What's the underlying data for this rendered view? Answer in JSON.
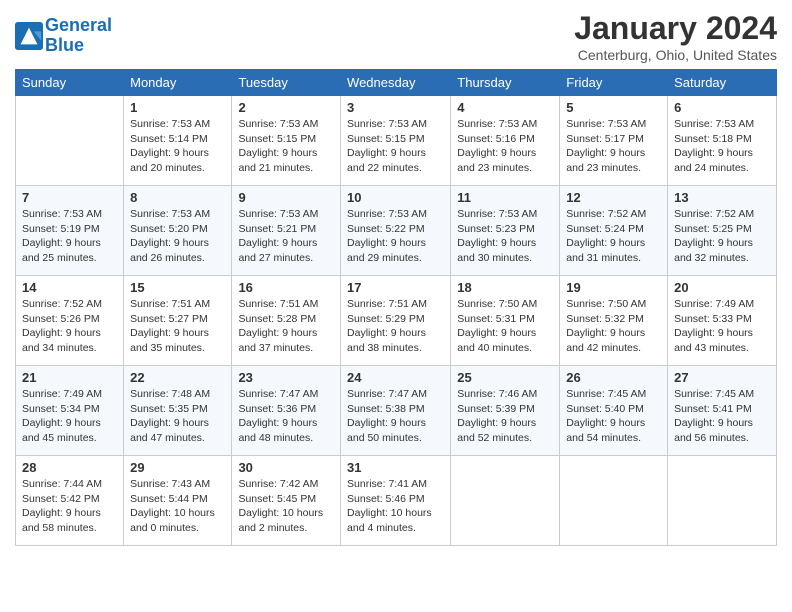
{
  "header": {
    "logo_line1": "General",
    "logo_line2": "Blue",
    "month": "January 2024",
    "location": "Centerburg, Ohio, United States"
  },
  "weekdays": [
    "Sunday",
    "Monday",
    "Tuesday",
    "Wednesday",
    "Thursday",
    "Friday",
    "Saturday"
  ],
  "weeks": [
    [
      {
        "day": "",
        "text": ""
      },
      {
        "day": "1",
        "text": "Sunrise: 7:53 AM\nSunset: 5:14 PM\nDaylight: 9 hours\nand 20 minutes."
      },
      {
        "day": "2",
        "text": "Sunrise: 7:53 AM\nSunset: 5:15 PM\nDaylight: 9 hours\nand 21 minutes."
      },
      {
        "day": "3",
        "text": "Sunrise: 7:53 AM\nSunset: 5:15 PM\nDaylight: 9 hours\nand 22 minutes."
      },
      {
        "day": "4",
        "text": "Sunrise: 7:53 AM\nSunset: 5:16 PM\nDaylight: 9 hours\nand 23 minutes."
      },
      {
        "day": "5",
        "text": "Sunrise: 7:53 AM\nSunset: 5:17 PM\nDaylight: 9 hours\nand 23 minutes."
      },
      {
        "day": "6",
        "text": "Sunrise: 7:53 AM\nSunset: 5:18 PM\nDaylight: 9 hours\nand 24 minutes."
      }
    ],
    [
      {
        "day": "7",
        "text": "Sunrise: 7:53 AM\nSunset: 5:19 PM\nDaylight: 9 hours\nand 25 minutes."
      },
      {
        "day": "8",
        "text": "Sunrise: 7:53 AM\nSunset: 5:20 PM\nDaylight: 9 hours\nand 26 minutes."
      },
      {
        "day": "9",
        "text": "Sunrise: 7:53 AM\nSunset: 5:21 PM\nDaylight: 9 hours\nand 27 minutes."
      },
      {
        "day": "10",
        "text": "Sunrise: 7:53 AM\nSunset: 5:22 PM\nDaylight: 9 hours\nand 29 minutes."
      },
      {
        "day": "11",
        "text": "Sunrise: 7:53 AM\nSunset: 5:23 PM\nDaylight: 9 hours\nand 30 minutes."
      },
      {
        "day": "12",
        "text": "Sunrise: 7:52 AM\nSunset: 5:24 PM\nDaylight: 9 hours\nand 31 minutes."
      },
      {
        "day": "13",
        "text": "Sunrise: 7:52 AM\nSunset: 5:25 PM\nDaylight: 9 hours\nand 32 minutes."
      }
    ],
    [
      {
        "day": "14",
        "text": "Sunrise: 7:52 AM\nSunset: 5:26 PM\nDaylight: 9 hours\nand 34 minutes."
      },
      {
        "day": "15",
        "text": "Sunrise: 7:51 AM\nSunset: 5:27 PM\nDaylight: 9 hours\nand 35 minutes."
      },
      {
        "day": "16",
        "text": "Sunrise: 7:51 AM\nSunset: 5:28 PM\nDaylight: 9 hours\nand 37 minutes."
      },
      {
        "day": "17",
        "text": "Sunrise: 7:51 AM\nSunset: 5:29 PM\nDaylight: 9 hours\nand 38 minutes."
      },
      {
        "day": "18",
        "text": "Sunrise: 7:50 AM\nSunset: 5:31 PM\nDaylight: 9 hours\nand 40 minutes."
      },
      {
        "day": "19",
        "text": "Sunrise: 7:50 AM\nSunset: 5:32 PM\nDaylight: 9 hours\nand 42 minutes."
      },
      {
        "day": "20",
        "text": "Sunrise: 7:49 AM\nSunset: 5:33 PM\nDaylight: 9 hours\nand 43 minutes."
      }
    ],
    [
      {
        "day": "21",
        "text": "Sunrise: 7:49 AM\nSunset: 5:34 PM\nDaylight: 9 hours\nand 45 minutes."
      },
      {
        "day": "22",
        "text": "Sunrise: 7:48 AM\nSunset: 5:35 PM\nDaylight: 9 hours\nand 47 minutes."
      },
      {
        "day": "23",
        "text": "Sunrise: 7:47 AM\nSunset: 5:36 PM\nDaylight: 9 hours\nand 48 minutes."
      },
      {
        "day": "24",
        "text": "Sunrise: 7:47 AM\nSunset: 5:38 PM\nDaylight: 9 hours\nand 50 minutes."
      },
      {
        "day": "25",
        "text": "Sunrise: 7:46 AM\nSunset: 5:39 PM\nDaylight: 9 hours\nand 52 minutes."
      },
      {
        "day": "26",
        "text": "Sunrise: 7:45 AM\nSunset: 5:40 PM\nDaylight: 9 hours\nand 54 minutes."
      },
      {
        "day": "27",
        "text": "Sunrise: 7:45 AM\nSunset: 5:41 PM\nDaylight: 9 hours\nand 56 minutes."
      }
    ],
    [
      {
        "day": "28",
        "text": "Sunrise: 7:44 AM\nSunset: 5:42 PM\nDaylight: 9 hours\nand 58 minutes."
      },
      {
        "day": "29",
        "text": "Sunrise: 7:43 AM\nSunset: 5:44 PM\nDaylight: 10 hours\nand 0 minutes."
      },
      {
        "day": "30",
        "text": "Sunrise: 7:42 AM\nSunset: 5:45 PM\nDaylight: 10 hours\nand 2 minutes."
      },
      {
        "day": "31",
        "text": "Sunrise: 7:41 AM\nSunset: 5:46 PM\nDaylight: 10 hours\nand 4 minutes."
      },
      {
        "day": "",
        "text": ""
      },
      {
        "day": "",
        "text": ""
      },
      {
        "day": "",
        "text": ""
      }
    ]
  ]
}
